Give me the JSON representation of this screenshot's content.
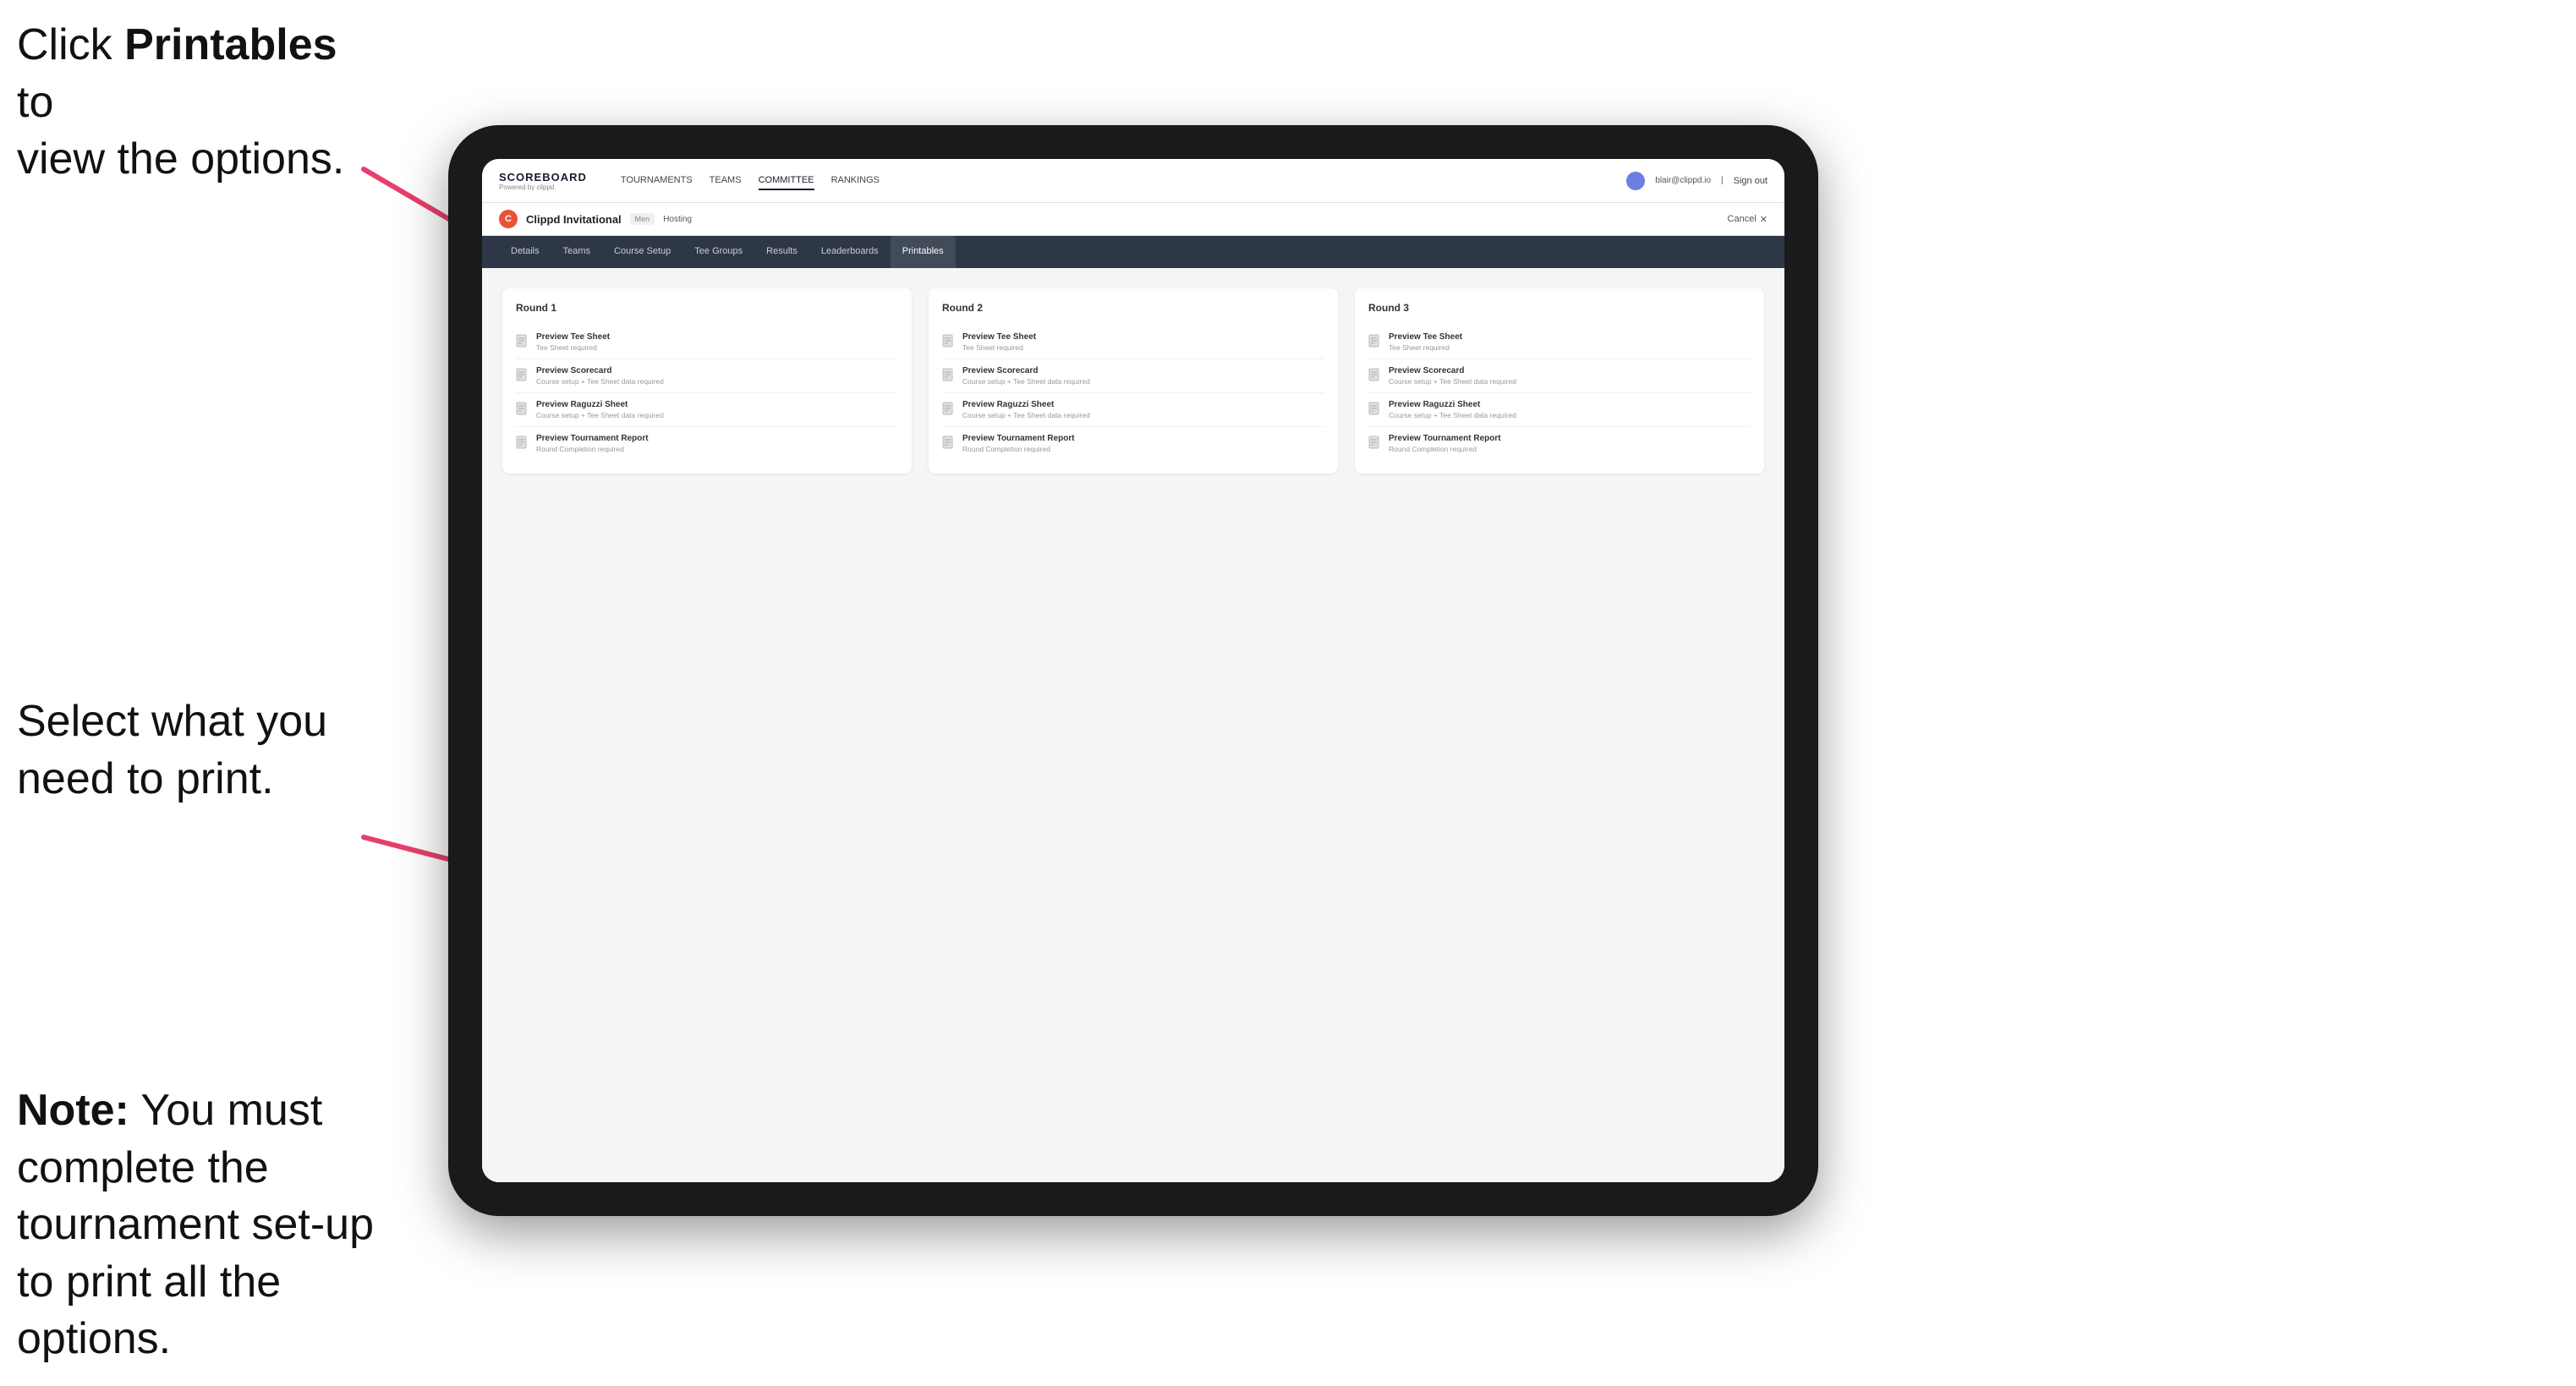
{
  "annotations": {
    "top": {
      "line1": "Click ",
      "bold": "Printables",
      "line2": " to",
      "line3": "view the options."
    },
    "middle": {
      "line1": "Select what you",
      "line2": "need to print."
    },
    "bottom": {
      "bold_prefix": "Note:",
      "line1": " You must",
      "line2": "complete the",
      "line3": "tournament set-up",
      "line4": "to print all the options."
    }
  },
  "topnav": {
    "brand_title": "SCOREBOARD",
    "brand_sub": "Powered by clippd",
    "links": [
      "TOURNAMENTS",
      "TEAMS",
      "COMMITTEE",
      "RANKINGS"
    ],
    "active_link": "COMMITTEE",
    "user_email": "blair@clippd.io",
    "sign_out": "Sign out"
  },
  "tournament": {
    "logo_letter": "C",
    "name": "Clippd Invitational",
    "badge": "Men",
    "status": "Hosting",
    "cancel": "Cancel"
  },
  "sub_tabs": {
    "tabs": [
      "Details",
      "Teams",
      "Course Setup",
      "Tee Groups",
      "Results",
      "Leaderboards",
      "Printables"
    ],
    "active": "Printables"
  },
  "rounds": [
    {
      "title": "Round 1",
      "options": [
        {
          "title": "Preview Tee Sheet",
          "sub": "Tee Sheet required"
        },
        {
          "title": "Preview Scorecard",
          "sub": "Course setup + Tee Sheet data required"
        },
        {
          "title": "Preview Raguzzi Sheet",
          "sub": "Course setup + Tee Sheet data required"
        },
        {
          "title": "Preview Tournament Report",
          "sub": "Round Completion required"
        }
      ]
    },
    {
      "title": "Round 2",
      "options": [
        {
          "title": "Preview Tee Sheet",
          "sub": "Tee Sheet required"
        },
        {
          "title": "Preview Scorecard",
          "sub": "Course setup + Tee Sheet data required"
        },
        {
          "title": "Preview Raguzzi Sheet",
          "sub": "Course setup + Tee Sheet data required"
        },
        {
          "title": "Preview Tournament Report",
          "sub": "Round Completion required"
        }
      ]
    },
    {
      "title": "Round 3",
      "options": [
        {
          "title": "Preview Tee Sheet",
          "sub": "Tee Sheet required"
        },
        {
          "title": "Preview Scorecard",
          "sub": "Course setup + Tee Sheet data required"
        },
        {
          "title": "Preview Raguzzi Sheet",
          "sub": "Course setup + Tee Sheet data required"
        },
        {
          "title": "Preview Tournament Report",
          "sub": "Round Completion required"
        }
      ]
    }
  ]
}
